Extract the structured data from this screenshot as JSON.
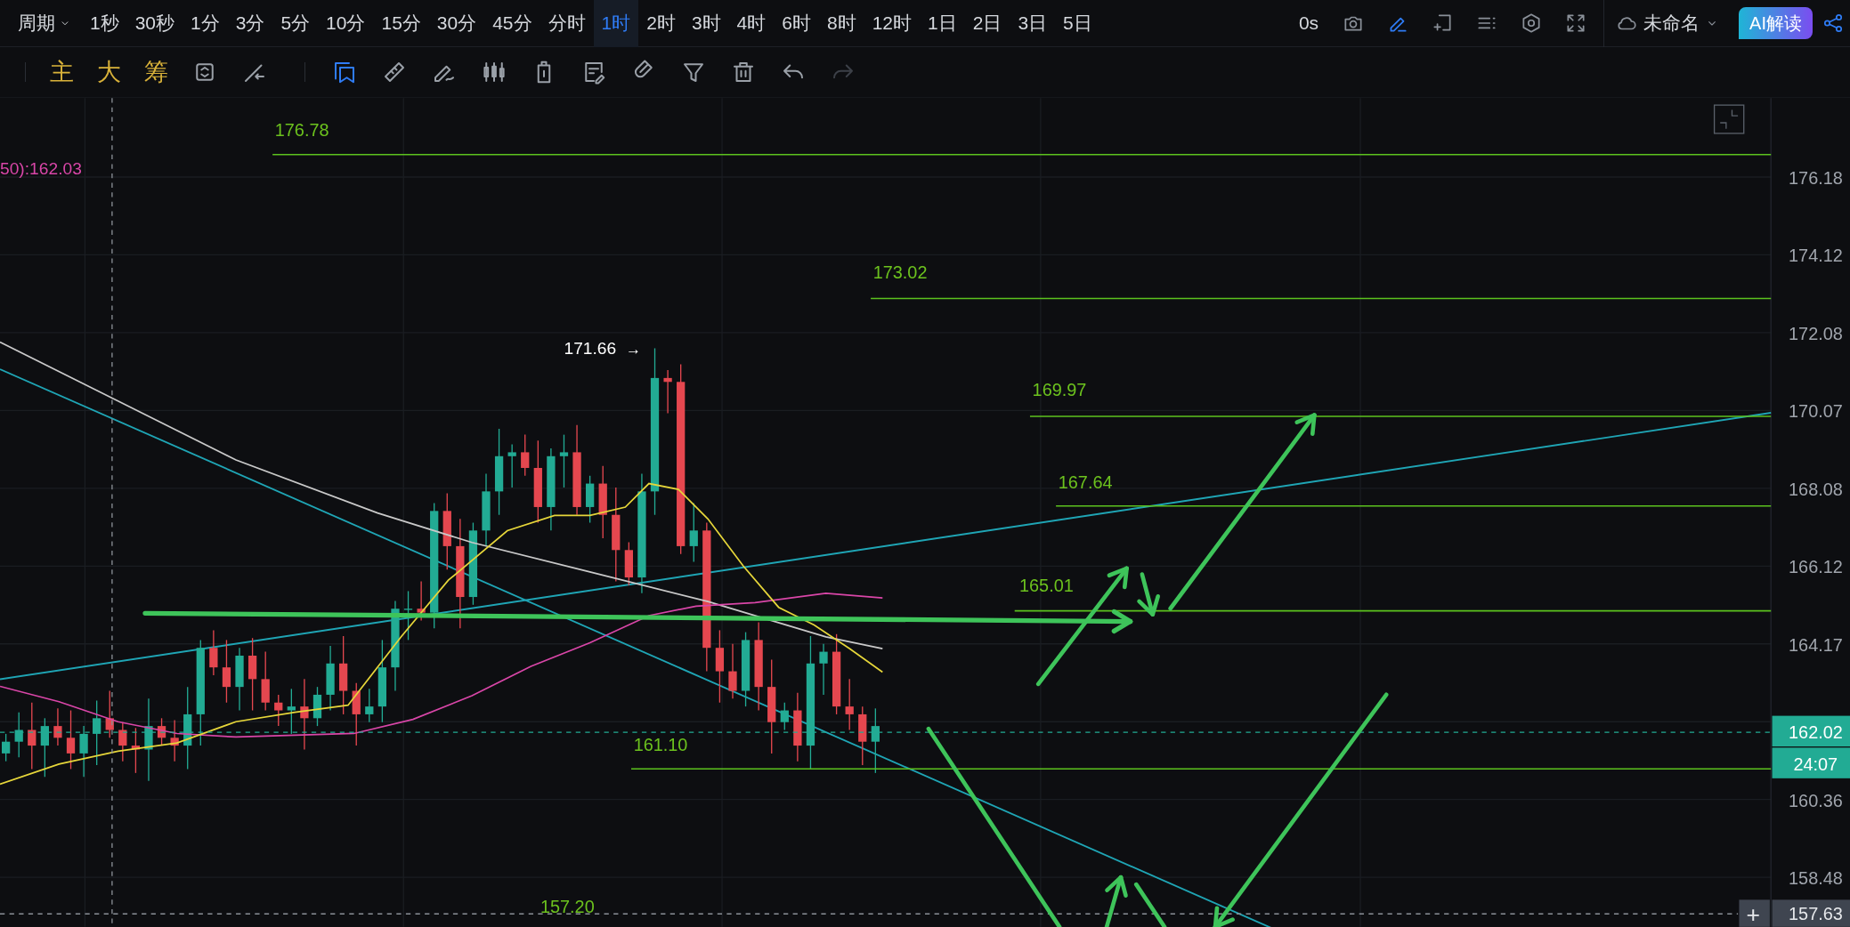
{
  "header": {
    "period_menu": "周期",
    "intervals": [
      {
        "label": "1秒",
        "selected": false
      },
      {
        "label": "30秒",
        "selected": false
      },
      {
        "label": "1分",
        "selected": false
      },
      {
        "label": "3分",
        "selected": false
      },
      {
        "label": "5分",
        "selected": false
      },
      {
        "label": "10分",
        "selected": false
      },
      {
        "label": "15分",
        "selected": false
      },
      {
        "label": "30分",
        "selected": false
      },
      {
        "label": "45分",
        "selected": false
      },
      {
        "label": "分时",
        "selected": false
      },
      {
        "label": "1时",
        "selected": true
      },
      {
        "label": "2时",
        "selected": false
      },
      {
        "label": "3时",
        "selected": false
      },
      {
        "label": "4时",
        "selected": false
      },
      {
        "label": "6时",
        "selected": false
      },
      {
        "label": "8时",
        "selected": false
      },
      {
        "label": "12时",
        "selected": false
      },
      {
        "label": "1日",
        "selected": false
      },
      {
        "label": "2日",
        "selected": false
      },
      {
        "label": "3日",
        "selected": false
      },
      {
        "label": "5日",
        "selected": false
      }
    ],
    "countdown": "0s",
    "draw_mode": {
      "on": true
    },
    "workspace_name": "未命名",
    "ai_button": "AI解读"
  },
  "toolbar": {
    "overlay_buttons": [
      "主",
      "大",
      "筹"
    ],
    "history": [
      {
        "kind": "undo",
        "disabled": false
      },
      {
        "kind": "redo",
        "disabled": true
      }
    ]
  },
  "chart": {
    "indicator_readout": "50):162.03",
    "high_marker": {
      "price": "171.66",
      "arrow": "→"
    },
    "levels": [
      {
        "label": "176.78"
      },
      {
        "label": "173.02"
      },
      {
        "label": "169.97"
      },
      {
        "label": "167.64"
      },
      {
        "label": "165.01"
      },
      {
        "label": "161.10"
      },
      {
        "label": "157.20"
      }
    ],
    "price_axis": {
      "ticks": [
        "176.18",
        "174.12",
        "172.08",
        "170.07",
        "168.08",
        "166.12",
        "164.17",
        "160.36",
        "158.48"
      ],
      "last_price": "162.02",
      "bar_countdown": "24:07",
      "crosshair_price": "157.63",
      "crosshair_button": "+"
    }
  }
}
